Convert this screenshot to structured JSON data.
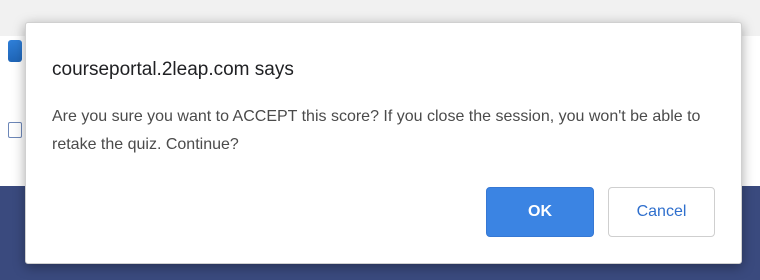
{
  "dialog": {
    "title": "courseportal.2leap.com says",
    "message": "Are you sure you want to ACCEPT this score? If you close the session, you won't be able to retake the quiz. Continue?",
    "buttons": {
      "ok_label": "OK",
      "cancel_label": "Cancel"
    }
  },
  "colors": {
    "ok_button": "#3b84e3",
    "cancel_text": "#2f6fcd",
    "background_band": "#3a4a7e"
  }
}
